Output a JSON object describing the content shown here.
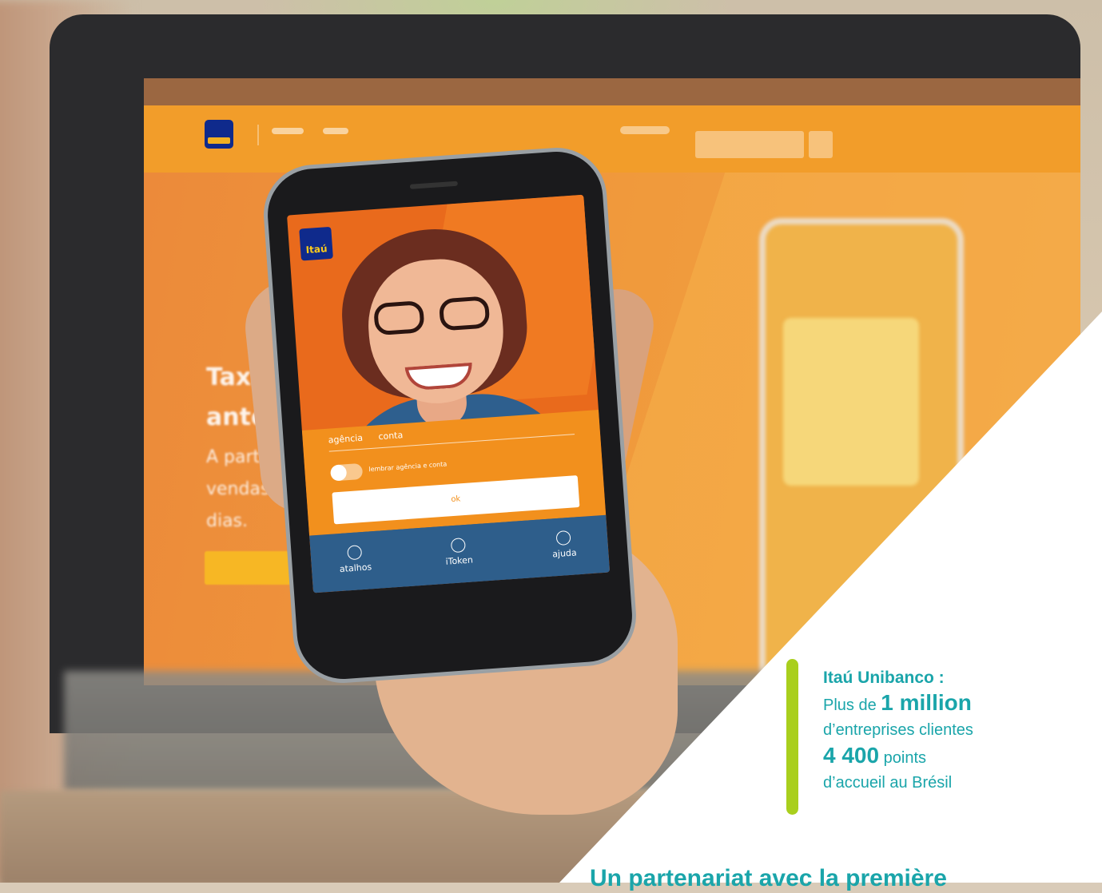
{
  "colors": {
    "accent": "#1aa5aa",
    "highlight_bar": "#a9cf1d",
    "itau_orange": "#f2901d",
    "itau_blue": "#0f2a8c"
  },
  "laptop_site": {
    "heading_line1": "Taxa zero d",
    "heading_line2": "antecipação",
    "body_line1": "A partir de 2 de",
    "body_line2": "vendas no crédit",
    "body_line3": "dias."
  },
  "phone_app": {
    "logo": "Itaú",
    "tabs": [
      "agência",
      "conta"
    ],
    "remember_label": "lembrar agência e conta",
    "submit_label": "ok",
    "footer": [
      {
        "label": "atalhos",
        "icon": "shortcut-icon"
      },
      {
        "label": "iToken",
        "icon": "token-icon"
      },
      {
        "label": "ajuda",
        "icon": "help-chat-icon"
      }
    ]
  },
  "stats": {
    "title": "Itaú Unibanco :",
    "line1_prefix": "Plus de ",
    "line1_big": "1 million",
    "line2": "d’entreprises clientes",
    "line3_big": "4 400",
    "line3_suffix": " points",
    "line4": "d’accueil au Brésil"
  },
  "headline": "Un partenariat avec la première"
}
